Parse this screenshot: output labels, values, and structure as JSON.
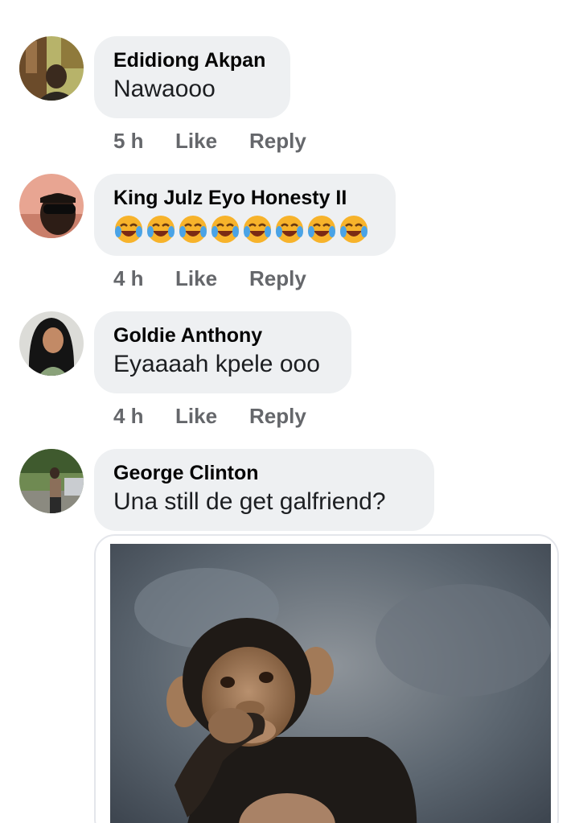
{
  "comments": [
    {
      "author": "Edidiong Akpan",
      "text": "Nawaooo",
      "time": "5 h",
      "like_label": "Like",
      "reply_label": "Reply",
      "avatar_icon": "profile-photo"
    },
    {
      "author": "King Julz Eyo Honesty II",
      "emoji": "😂😂😂😂😂😂😂😂",
      "time": "4 h",
      "like_label": "Like",
      "reply_label": "Reply",
      "avatar_icon": "profile-photo"
    },
    {
      "author": "Goldie Anthony",
      "text": "Eyaaaah kpele ooo",
      "time": "4 h",
      "like_label": "Like",
      "reply_label": "Reply",
      "avatar_icon": "profile-photo"
    },
    {
      "author": "George Clinton",
      "text": "Una still de get galfriend?",
      "avatar_icon": "profile-photo",
      "attachment": "chimpanzee-photo"
    }
  ],
  "colors": {
    "bubble": "#eef0f2",
    "author": "#050505",
    "meta": "#65676b"
  }
}
